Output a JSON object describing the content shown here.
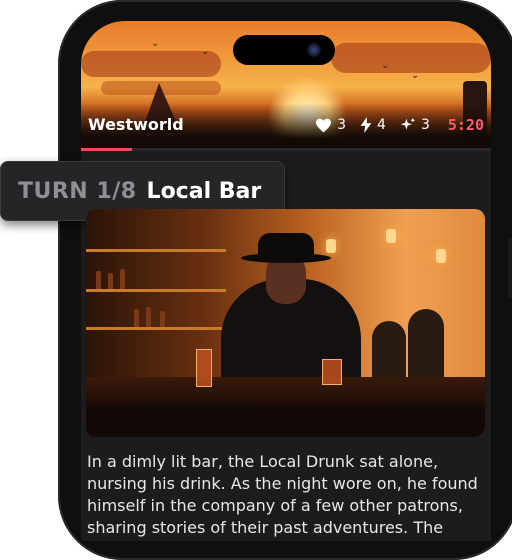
{
  "header": {
    "world_name": "Westworld",
    "stats": {
      "hearts": "3",
      "energy": "4",
      "sparkles": "3"
    },
    "timer": "5:20",
    "progress_fraction": 0.125,
    "accent_color": "#ef4a5c"
  },
  "turn": {
    "label": "TURN 1/8",
    "location": "Local Bar"
  },
  "scene": {
    "image": "western-bar-cowboy-illustration"
  },
  "story": {
    "text": "In a dimly lit bar, the Local Drunk sat alone, nursing his drink. As the night wore on, he found himself in the company of a few other patrons, sharing stories of their past adventures. The"
  }
}
